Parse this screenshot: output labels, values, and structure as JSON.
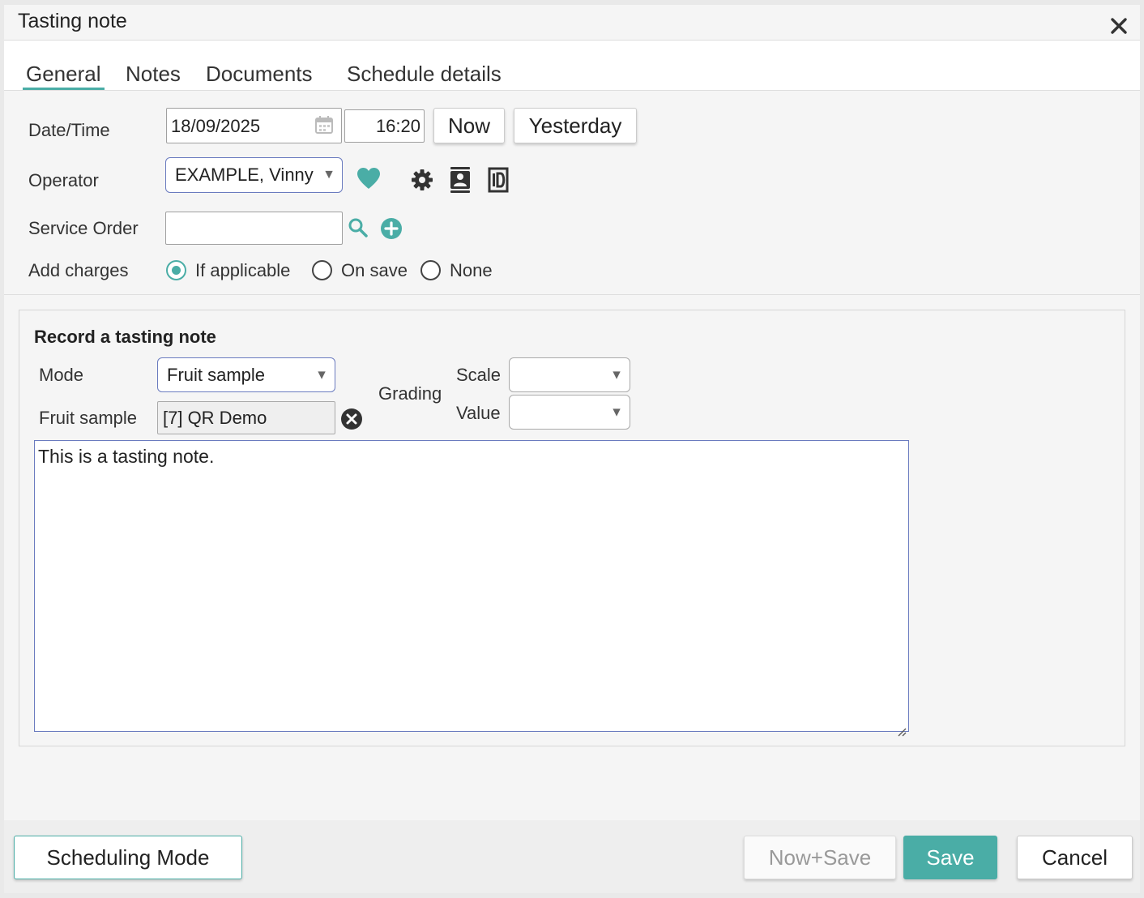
{
  "dialog": {
    "title": "Tasting note",
    "close_icon": "close-icon"
  },
  "tabs": [
    {
      "label": "General",
      "active": true
    },
    {
      "label": "Notes",
      "active": false
    },
    {
      "label": "Documents",
      "active": false
    },
    {
      "label": "Schedule details",
      "active": false
    }
  ],
  "form": {
    "datetime": {
      "label": "Date/Time",
      "date_value": "18/09/2025",
      "time_value": "16:20",
      "now_label": "Now",
      "yesterday_label": "Yesterday"
    },
    "operator": {
      "label": "Operator",
      "value": "EXAMPLE, Vinny"
    },
    "service_order": {
      "label": "Service Order",
      "value": ""
    },
    "add_charges": {
      "label": "Add charges",
      "options": [
        {
          "label": "If applicable",
          "selected": true
        },
        {
          "label": "On save",
          "selected": false
        },
        {
          "label": "None",
          "selected": false
        }
      ]
    }
  },
  "record": {
    "title": "Record a tasting note",
    "mode_label": "Mode",
    "mode_value": "Fruit sample",
    "fruit_sample_label": "Fruit sample",
    "fruit_sample_value": "[7] QR Demo",
    "grading_label": "Grading",
    "scale_label": "Scale",
    "scale_value": "",
    "value_label": "Value",
    "value_value": "",
    "note_text": "This is a tasting note."
  },
  "footer": {
    "scheduling_mode_label": "Scheduling Mode",
    "now_save_label": "Now+Save",
    "save_label": "Save",
    "cancel_label": "Cancel"
  },
  "colors": {
    "accent": "#4aada6",
    "select_border": "#6a7bbf",
    "dark_icon": "#333333"
  }
}
